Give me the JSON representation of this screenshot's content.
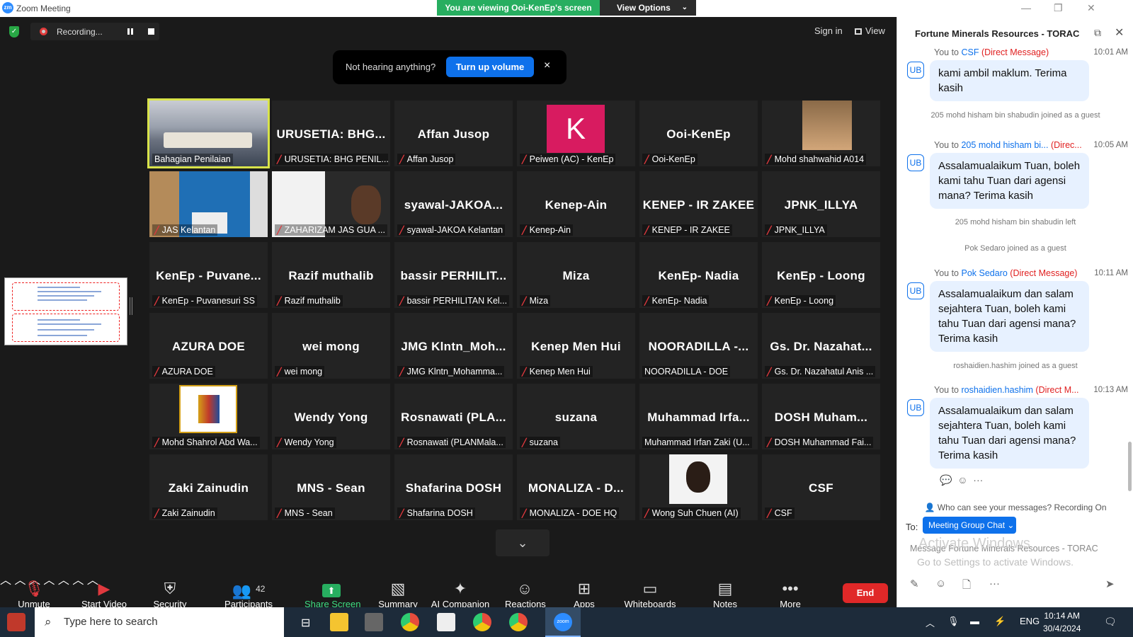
{
  "window": {
    "app_title": "Zoom Meeting",
    "viewing_banner": "You are viewing Ooi-KenEp's screen",
    "view_options": "View Options"
  },
  "top": {
    "recording": "Recording...",
    "sign_in": "Sign in",
    "view": "View"
  },
  "notice": {
    "text": "Not hearing anything?",
    "button": "Turn up volume",
    "close": "×"
  },
  "tiles": [
    {
      "name": "",
      "label": "Bahagian Penilaian",
      "muted": false,
      "video": "room",
      "active": true
    },
    {
      "name": "URUSETIA: BHG...",
      "label": "URUSETIA: BHG PENIL...",
      "muted": true
    },
    {
      "name": "Affan Jusop",
      "label": "Affan Jusop",
      "muted": true
    },
    {
      "name": "",
      "label": "Peiwen (AC) - KenEp",
      "muted": true,
      "avatar": "K"
    },
    {
      "name": "Ooi-KenEp",
      "label": "Ooi-KenEp",
      "muted": true
    },
    {
      "name": "",
      "label": "Mohd shahwahid A014",
      "muted": true,
      "video": "man"
    },
    {
      "name": "",
      "label": "JAS Kelantan",
      "muted": true,
      "video": "jas"
    },
    {
      "name": "",
      "label": "ZAHARIZAM JAS GUA ...",
      "muted": true,
      "video": "face"
    },
    {
      "name": "syawal-JAKOA...",
      "label": "syawal-JAKOA Kelantan",
      "muted": true
    },
    {
      "name": "Kenep-Ain",
      "label": "Kenep-Ain",
      "muted": true
    },
    {
      "name": "KENEP - IR ZAKEE",
      "label": "KENEP - IR ZAKEE",
      "muted": true
    },
    {
      "name": "JPNK_ILLYA",
      "label": "JPNK_ILLYA",
      "muted": true
    },
    {
      "name": "KenEp - Puvane...",
      "label": "KenEp - Puvanesuri SS",
      "muted": true
    },
    {
      "name": "Razif muthalib",
      "label": "Razif muthalib",
      "muted": true
    },
    {
      "name": "bassir PERHILIT...",
      "label": "bassir PERHILITAN Kel...",
      "muted": true
    },
    {
      "name": "Miza",
      "label": "Miza",
      "muted": true
    },
    {
      "name": "KenEp- Nadia",
      "label": "KenEp- Nadia",
      "muted": true
    },
    {
      "name": "KenEp - Loong",
      "label": "KenEp - Loong",
      "muted": true
    },
    {
      "name": "AZURA DOE",
      "label": "AZURA DOE",
      "muted": true
    },
    {
      "name": "wei mong",
      "label": "wei mong",
      "muted": true
    },
    {
      "name": "JMG Klntn_Moh...",
      "label": "JMG Klntn_Mohamma...",
      "muted": true
    },
    {
      "name": "Kenep Men Hui",
      "label": "Kenep Men Hui",
      "muted": true
    },
    {
      "name": "NOORADILLA -...",
      "label": "NOORADILLA - DOE",
      "muted": false
    },
    {
      "name": "Gs. Dr. Nazahat...",
      "label": "Gs. Dr. Nazahatul Anis ...",
      "muted": true
    },
    {
      "name": "",
      "label": "Mohd Shahrol Abd Wa...",
      "muted": true,
      "video": "crest"
    },
    {
      "name": "Wendy Yong",
      "label": "Wendy Yong",
      "muted": true
    },
    {
      "name": "Rosnawati (PLA...",
      "label": "Rosnawati (PLANMala...",
      "muted": true
    },
    {
      "name": "suzana",
      "label": "suzana",
      "muted": true
    },
    {
      "name": "Muhammad Irfa...",
      "label": "Muhammad Irfan Zaki (U...",
      "muted": false
    },
    {
      "name": "DOSH Muham...",
      "label": "DOSH Muhammad Fai...",
      "muted": true
    },
    {
      "name": "Zaki Zainudin",
      "label": "Zaki Zainudin",
      "muted": true
    },
    {
      "name": "MNS - Sean",
      "label": "MNS - Sean",
      "muted": true
    },
    {
      "name": "Shafarina DOSH",
      "label": "Shafarina DOSH",
      "muted": true
    },
    {
      "name": "MONALIZA - D...",
      "label": "MONALIZA - DOE HQ",
      "muted": true
    },
    {
      "name": "",
      "label": "Wong Suh Chuen (AI)",
      "muted": true,
      "video": "woman"
    },
    {
      "name": "CSF",
      "label": "CSF",
      "muted": true
    }
  ],
  "toolbar": {
    "unmute": "Unmute",
    "start_video": "Start Video",
    "security": "Security",
    "participants": "Participants",
    "participants_count": "42",
    "share_screen": "Share Screen",
    "summary": "Summary",
    "ai_companion": "AI Companion",
    "reactions": "Reactions",
    "apps": "Apps",
    "whiteboards": "Whiteboards",
    "notes": "Notes",
    "more": "More",
    "end": "End"
  },
  "chat": {
    "title": "Fortune Minerals Resources - TORAC",
    "avatar": "UB",
    "m1": {
      "prefix": "You to",
      "to": "CSF",
      "dm": "(Direct Message)",
      "time": "10:01 AM",
      "text": "kami ambil maklum. Terima kasih"
    },
    "s1": "205 mohd hisham bin shabudin joined as a guest",
    "m2": {
      "prefix": "You to",
      "to": "205 mohd hisham bi...",
      "dm": "(Direc...",
      "time": "10:05 AM",
      "text": "Assalamualaikum Tuan, boleh kami tahu Tuan dari agensi mana? Terima kasih"
    },
    "s2": "205 mohd hisham bin shabudin left",
    "s3": "Pok Sedaro joined as a guest",
    "m3": {
      "prefix": "You to",
      "to": "Pok Sedaro",
      "dm": "(Direct Message)",
      "time": "10:11 AM",
      "text": "Assalamualaikum dan salam sejahtera Tuan, boleh kami tahu Tuan dari agensi mana? Terima kasih"
    },
    "s4": "roshaidien.hashim joined as a guest",
    "m4": {
      "prefix": "You to",
      "to": "roshaidien.hashim",
      "dm": "(Direct M...",
      "time": "10:13 AM",
      "text": "Assalamualaikum dan salam sejahtera Tuan, boleh kami tahu Tuan dari agensi mana? Terima kasih"
    },
    "who_can_see": "Who can see your messages? Recording On",
    "to_label": "To:",
    "to_value": "Meeting Group Chat",
    "placeholder": "Message Fortune Minerals Resources - TORAC",
    "activate1": "Activate Windows",
    "activate2": "Go to Settings to activate Windows."
  },
  "taskbar": {
    "search_placeholder": "Type here to search",
    "lang": "ENG",
    "time": "10:14 AM",
    "date": "30/4/2024",
    "notif": "1"
  }
}
